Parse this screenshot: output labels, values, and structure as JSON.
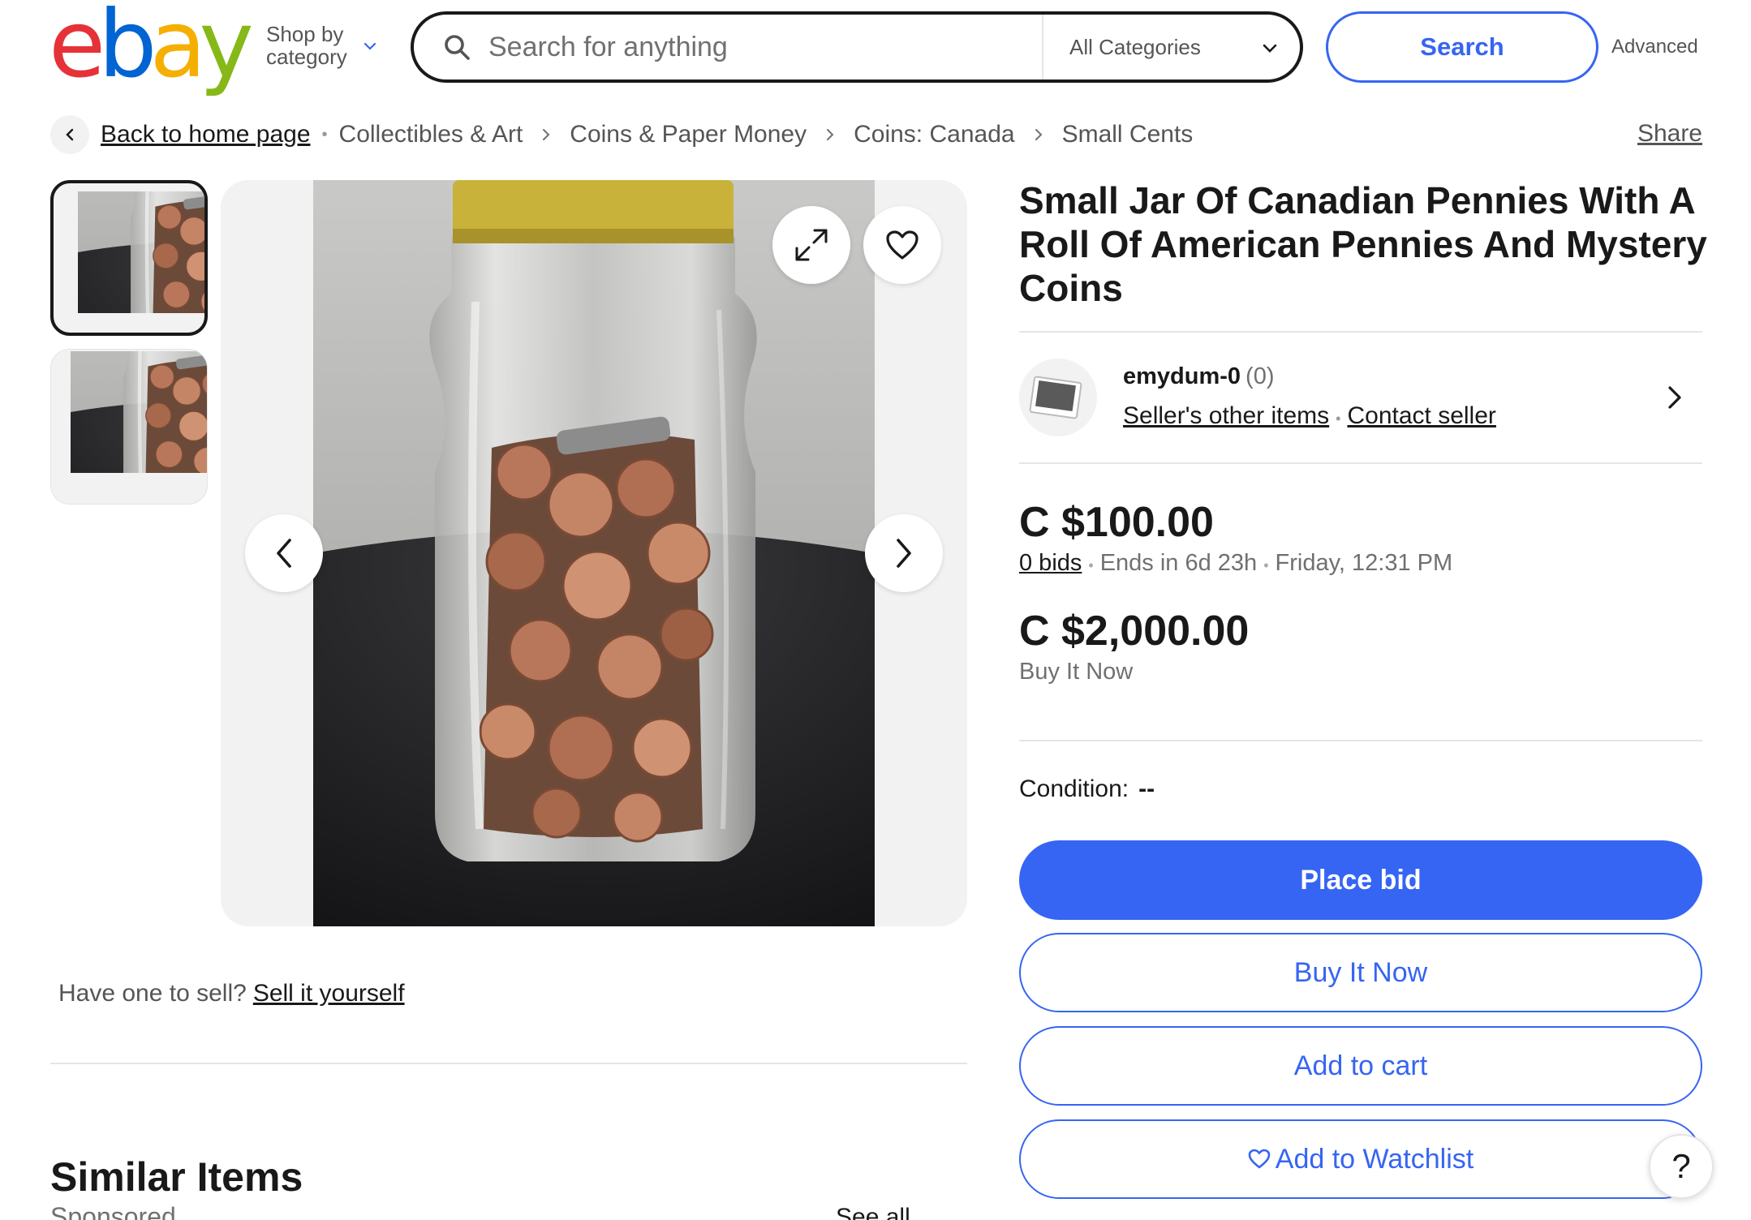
{
  "header": {
    "logo_letters": [
      "e",
      "b",
      "a",
      "y"
    ],
    "shop_by_category": "Shop by category",
    "search_placeholder": "Search for anything",
    "category_select": "All Categories",
    "search_button": "Search",
    "advanced_link": "Advanced"
  },
  "breadcrumb": {
    "back": "Back to home page",
    "items": [
      "Collectibles & Art",
      "Coins & Paper Money",
      "Coins: Canada",
      "Small Cents"
    ],
    "share": "Share"
  },
  "listing": {
    "title": "Small Jar Of Canadian Pennies With A Roll Of American Pennies And Mystery Coins",
    "seller": {
      "name": "emydum-0",
      "feedback": "(0)",
      "other_items": "Seller's other items",
      "contact": "Contact seller"
    },
    "auction_price": "C $100.00",
    "bids": "0 bids",
    "ends_in": "Ends in 6d 23h",
    "end_time": "Friday, 12:31 PM",
    "buy_it_now_price": "C $2,000.00",
    "buy_it_now_label": "Buy It Now",
    "condition_label": "Condition:",
    "condition_value": "--"
  },
  "actions": {
    "place_bid": "Place bid",
    "buy_it_now": "Buy It Now",
    "add_to_cart": "Add to cart",
    "add_to_watchlist": "Add to Watchlist"
  },
  "below_image": {
    "sell_prompt": "Have one to sell?",
    "sell_link": "Sell it yourself",
    "similar_heading": "Similar Items",
    "sponsored": "Sponsored",
    "see_all": "See all"
  },
  "help_button": "?",
  "colors": {
    "accent": "#3665f3",
    "logo_red": "#e53238",
    "logo_blue": "#0064d2",
    "logo_yellow": "#f5af02",
    "logo_green": "#86b817",
    "text_primary": "#191919",
    "text_secondary": "#707070"
  },
  "icons": {
    "search": "search-icon",
    "chevron_down": "chevron-down-icon",
    "back": "chevron-left-icon",
    "expand": "expand-icon",
    "watch": "heart-icon",
    "prev": "chevron-left-icon",
    "next": "chevron-right-icon",
    "seller": "chevron-right-icon",
    "help": "help-icon"
  }
}
